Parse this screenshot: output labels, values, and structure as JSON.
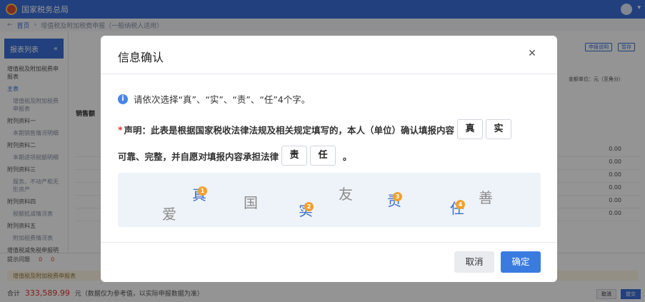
{
  "app": {
    "brand": "国家税务总局",
    "breadcrumb": [
      "首页",
      "增值税及附加税费申报（一般纳税人适用）"
    ],
    "sidebar_title": "报表列表",
    "sidebar_items": [
      "增值税及附加税费申报表",
      "主表",
      "增值税及附加税费申报表",
      "附列资料一",
      "本期销售情况明细",
      "附列资料二",
      "本期进项税额明细",
      "附列资料三",
      "服务、不动产和无形资产",
      "附列资料四",
      "税额抵减情况表",
      "附列资料五",
      "附加税费情况表",
      "增值税减免税申报明细表"
    ],
    "toolbar": [
      "申报说明",
      "暂存"
    ],
    "units_note": "金额单位：元（至角分）",
    "section_title": "销售额",
    "row_values": [
      "0.00",
      "0.00",
      "0.00",
      "0.00",
      "0.00",
      "0.00"
    ],
    "bottom_tabs": [
      "提示问题",
      "0",
      "0"
    ],
    "bottom_note": "增值税及附加税费申报表",
    "total_label": "合计",
    "total_amount": "333,589.99",
    "total_suffix": "元（数据仅为参考值，以实际申报数据为准）",
    "bottom_btn_left": "取消",
    "bottom_btn_right": "提交"
  },
  "dialog": {
    "title": "信息确认",
    "close_icon": "close-icon",
    "info_icon": "info-icon",
    "info_text": "请依次选择“真”、“实”、“责”、“任”4个字。",
    "required_mark": "*",
    "decl_line1": "声明：此表是根据国家税收法律法规及相关规定填写的，本人（单位）确认填报内容",
    "slots_line1": [
      "真",
      "实"
    ],
    "decl_line2": "可靠、完整，并自愿对填报内容承担法律",
    "slots_line2": [
      "责",
      "任"
    ],
    "decl_end": "。",
    "captcha_chars": [
      {
        "char": "爱",
        "color": "#8a8a8a"
      },
      {
        "char": "真",
        "color": "#3a6fc8",
        "marker": "1"
      },
      {
        "char": "国",
        "color": "#8a8a8a"
      },
      {
        "char": "实",
        "color": "#3a6fc8",
        "marker": "2"
      },
      {
        "char": "友",
        "color": "#8a8a8a"
      },
      {
        "char": "责",
        "color": "#3a6fc8",
        "marker": "3"
      },
      {
        "char": "任",
        "color": "#3a6fc8",
        "marker": "4"
      },
      {
        "char": "善",
        "color": "#8a8a8a"
      }
    ],
    "cancel_label": "取消",
    "confirm_label": "确定"
  }
}
